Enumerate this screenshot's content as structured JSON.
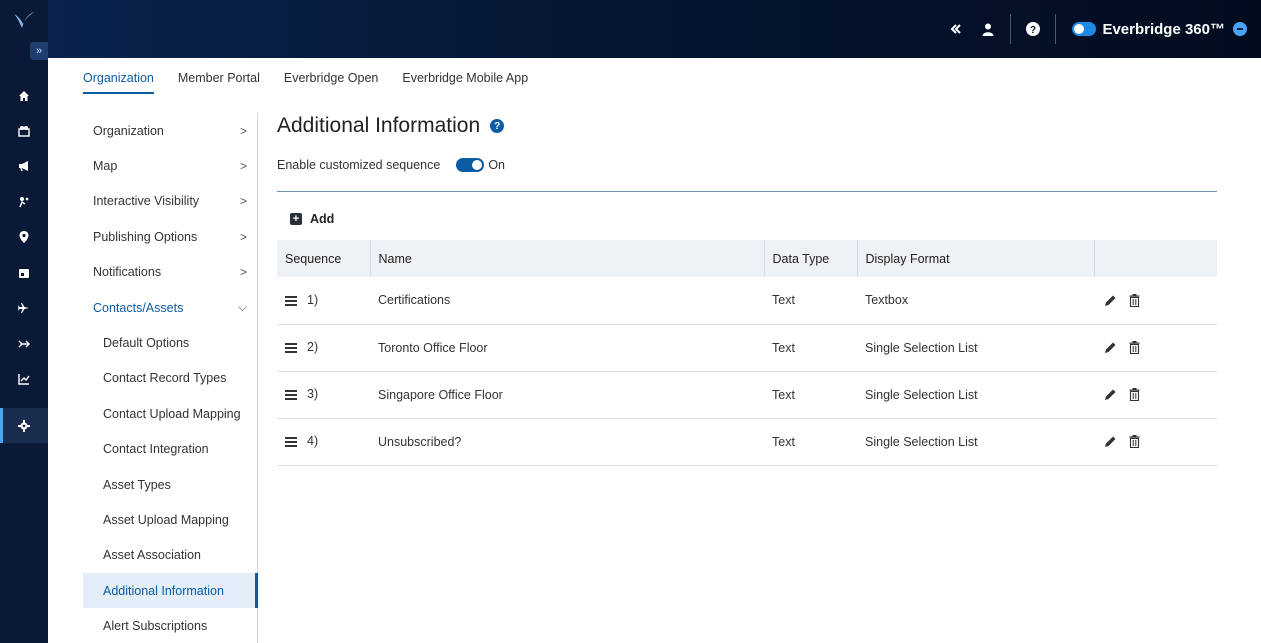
{
  "topbar": {
    "collapse_icon": "double-chevron-left-icon",
    "user_icon": "user-icon",
    "help_icon": "help-icon",
    "brand_name": "Everbridge 360™"
  },
  "rail": {
    "expand_label": "»",
    "items": [
      "home-icon",
      "contacts-icon",
      "megaphone-icon",
      "incident-icon",
      "location-icon",
      "calendar-icon",
      "travel-icon",
      "flight-icon",
      "analytics-icon",
      "settings-icon"
    ]
  },
  "tabs": [
    {
      "label": "Organization",
      "active": true
    },
    {
      "label": "Member Portal"
    },
    {
      "label": "Everbridge Open"
    },
    {
      "label": "Everbridge Mobile App"
    }
  ],
  "leftnav": {
    "items": [
      {
        "label": "Organization",
        "chevron": ">"
      },
      {
        "label": "Map",
        "chevron": ">"
      },
      {
        "label": "Interactive Visibility",
        "chevron": ">"
      },
      {
        "label": "Publishing Options",
        "chevron": ">"
      },
      {
        "label": "Notifications",
        "chevron": ">"
      },
      {
        "label": "Contacts/Assets",
        "chevron": "⌵"
      },
      {
        "label": "Default Options"
      },
      {
        "label": "Contact Record Types"
      },
      {
        "label": "Contact Upload Mapping"
      },
      {
        "label": "Contact Integration"
      },
      {
        "label": "Asset Types"
      },
      {
        "label": "Asset Upload Mapping"
      },
      {
        "label": "Asset Association"
      },
      {
        "label": "Additional Information"
      },
      {
        "label": "Alert Subscriptions"
      }
    ]
  },
  "main": {
    "title": "Additional Information",
    "help_glyph": "?",
    "sequence_label": "Enable customized sequence",
    "sequence_state": "On",
    "add_label": "Add",
    "add_glyph": "+",
    "columns": [
      "Sequence",
      "Name",
      "Data Type",
      "Display Format"
    ],
    "rows": [
      {
        "seq": "1)",
        "name": "Certifications",
        "type": "Text",
        "format": "Textbox"
      },
      {
        "seq": "2)",
        "name": "Toronto Office Floor",
        "type": "Text",
        "format": "Single Selection List"
      },
      {
        "seq": "3)",
        "name": "Singapore Office Floor",
        "type": "Text",
        "format": "Single Selection List"
      },
      {
        "seq": "4)",
        "name": "Unsubscribed?",
        "type": "Text",
        "format": "Single Selection List"
      }
    ]
  },
  "colors": {
    "accent": "#0b5ca3",
    "topbar": "#051733",
    "rail": "#0a1a36"
  }
}
